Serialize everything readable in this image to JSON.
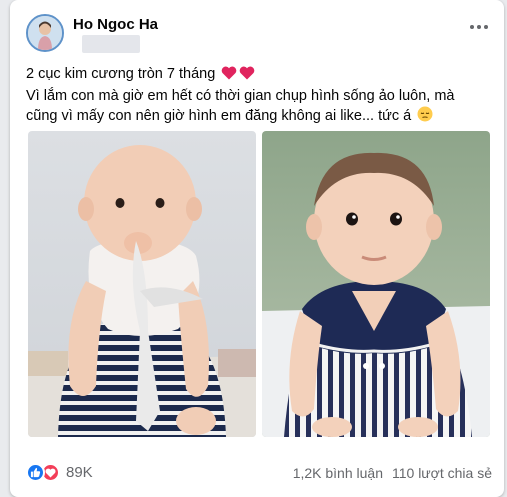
{
  "post": {
    "author": "Ho Ngoc Ha",
    "caption_line1": "2 cục kim cương tròn 7 tháng",
    "caption_line2": "Vì lắm con mà giờ em hết có thời gian chụp hình sống ảo luôn, mà",
    "caption_line3": "cũng vì mấy con nên giờ hình em đăng không ai like... tức á",
    "icons": [
      "heart-icon",
      "heart-icon",
      "pensive-face-icon",
      "more-options-icon",
      "like-reaction-icon",
      "love-reaction-icon"
    ]
  },
  "footer": {
    "reaction_count": "89K",
    "comments": "1,2K bình luận",
    "shares": "110 lượt chia sẻ"
  },
  "colors": {
    "like": "#1877f2",
    "love": "#f33e58",
    "secondary_text": "#65676b"
  }
}
